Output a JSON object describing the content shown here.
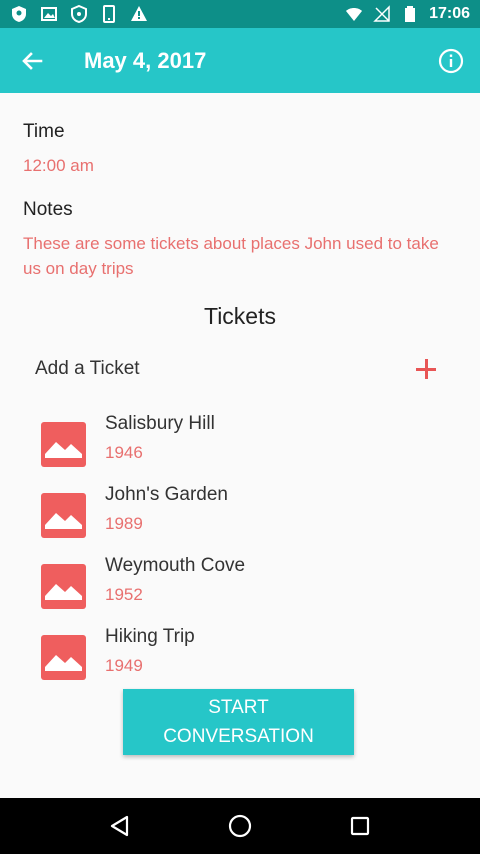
{
  "status_bar": {
    "time": "17:06",
    "left_icons": [
      "shield-icon",
      "image-icon",
      "vpn-icon",
      "phone-icon",
      "warning-icon"
    ],
    "right_icons": [
      "wifi-icon",
      "no-signal-icon",
      "battery-icon"
    ]
  },
  "app_bar": {
    "title": "May 4, 2017",
    "back_icon": "arrow-back-icon",
    "info_icon": "info-icon",
    "background": "#26c6c8"
  },
  "details": {
    "time_label": "Time",
    "time_value": "12:00 am",
    "notes_label": "Notes",
    "notes_value": "These are some tickets about places John used to take us on day trips"
  },
  "tickets": {
    "title": "Tickets",
    "add_label": "Add a Ticket",
    "items": [
      {
        "name": "Salisbury Hill",
        "year": "1946"
      },
      {
        "name": "John's Garden",
        "year": "1989"
      },
      {
        "name": "Weymouth Cove",
        "year": "1952"
      },
      {
        "name": "Hiking Trip",
        "year": "1949"
      }
    ]
  },
  "start_button": {
    "line1": "START",
    "line2": "CONVERSATION"
  },
  "colors": {
    "accent": "#26c6c8",
    "highlight_text": "#e8706f",
    "thumb": "#ef5e5e"
  },
  "nav_bar": {
    "buttons": [
      "back-triangle-icon",
      "home-circle-icon",
      "recents-square-icon"
    ]
  }
}
